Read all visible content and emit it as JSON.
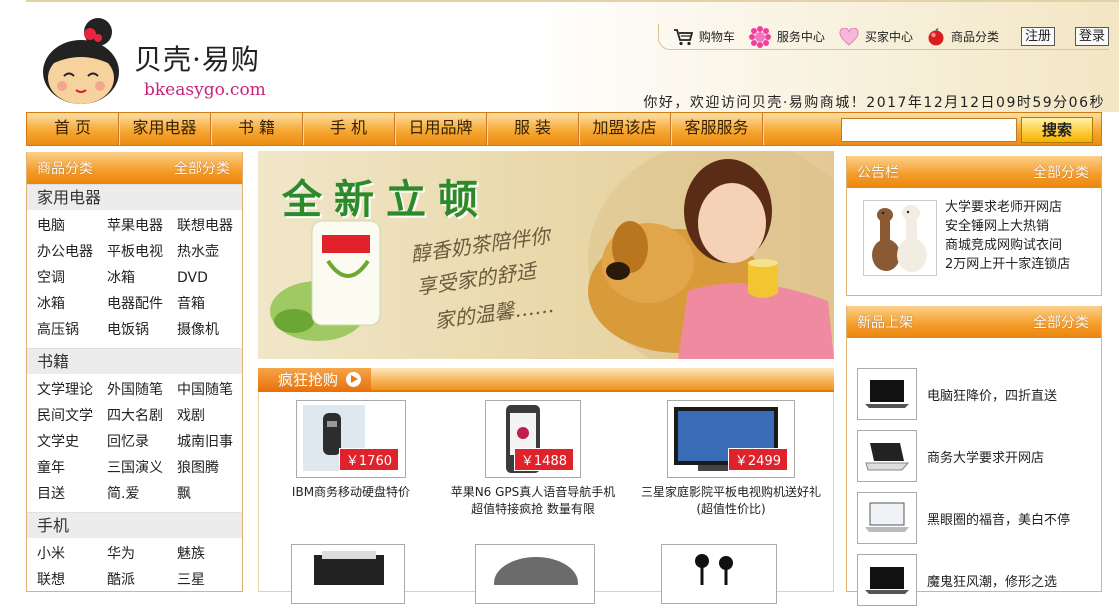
{
  "header": {
    "logo_name": "贝壳·易购",
    "logo_url": "bkeasygo.com",
    "links": [
      {
        "label": "购物车",
        "icon": "cart-icon"
      },
      {
        "label": "服务中心",
        "icon": "flower-icon"
      },
      {
        "label": "买家中心",
        "icon": "heart-icon"
      },
      {
        "label": "商品分类",
        "icon": "red-ball-icon"
      }
    ],
    "register": "注册",
    "login": "登录",
    "welcome": "你好，欢迎访问贝壳·易购商城！2017年12月12日09时59分06秒"
  },
  "nav": {
    "items": [
      "首 页",
      "家用电器",
      "书  籍",
      "手  机",
      "日用品牌",
      "服  装",
      "加盟该店",
      "客服服务"
    ],
    "search_placeholder": "",
    "search_button": "搜索"
  },
  "sidebar": {
    "title": "商品分类",
    "all": "全部分类",
    "categories": [
      {
        "name": "家用电器",
        "links": [
          "电脑",
          "苹果电器",
          "联想电器",
          "办公电器",
          "平板电视",
          "热水壶",
          "空调",
          "冰箱",
          "DVD",
          "冰箱",
          "电器配件",
          "音箱",
          "高压锅",
          "电饭锅",
          "摄像机"
        ]
      },
      {
        "name": "书籍",
        "links": [
          "文学理论",
          "外国随笔",
          "中国随笔",
          "民间文学",
          "四大名剧",
          "戏剧",
          "文学史",
          "回忆录",
          "城南旧事",
          "童年",
          "三国演义",
          "狼图腾",
          "目送",
          "简.爱",
          "飘"
        ]
      },
      {
        "name": "手机",
        "links": [
          "小米",
          "华为",
          "魅族",
          "联想",
          "酷派",
          "三星"
        ]
      }
    ]
  },
  "banner": {
    "title": "全新立顿",
    "lines": [
      "醇香奶茶陪伴你",
      "享受家的舒适",
      "家的温馨……"
    ]
  },
  "sale": {
    "title": "疯狂抢购",
    "products": [
      {
        "name": "IBM商务移动硬盘特价",
        "price": "￥1760"
      },
      {
        "name": "苹果N6 GPS真人语音导航手机 超值特接疯抢 数量有限",
        "price": "￥1488"
      },
      {
        "name": "三星家庭影院平板电视购机送好礼(超值性价比)",
        "price": "￥2499"
      }
    ]
  },
  "notice": {
    "title": "公告栏",
    "all": "全部分类",
    "items": [
      "大学要求老师开网店",
      "安全锤网上大热销",
      "商城竞成网购试衣间",
      "2万网上开十家连锁店"
    ]
  },
  "newin": {
    "title": "新品上架",
    "all": "全部分类",
    "items": [
      "电脑狂降价，四折直送",
      "商务大学要求开网店",
      "黑眼圈的福音，美白不停",
      "魔鬼狂风潮，修形之选"
    ]
  },
  "colors": {
    "accent": "#f49b27",
    "price_red": "#e0222a",
    "brand_pink": "#c8237a",
    "banner_green": "#2c8a2a"
  }
}
